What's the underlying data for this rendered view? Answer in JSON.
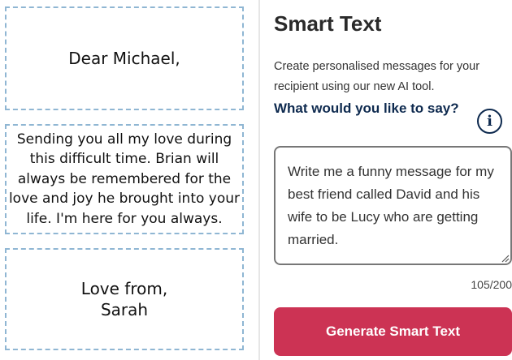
{
  "card": {
    "greeting": "Dear Michael,",
    "message_lines": [
      "Sending you all my love during",
      "this difficult time. Brian will",
      "always be remembered for the",
      "love and joy he brought into your",
      "life. I'm here for you always."
    ],
    "signoff_lines": [
      "Love from,",
      "Sarah"
    ]
  },
  "panel": {
    "title": "Smart Text",
    "description": "Create personalised messages for your recipient using our new AI tool.",
    "question": "What would you like to say?",
    "info_icon": "info-circle-icon",
    "prompt_value": "Write me a funny message for my best friend called David and his wife to be Lucy who are getting married.",
    "char_count": "105/200",
    "generate_label": "Generate Smart Text"
  },
  "colors": {
    "accent": "#cc3354",
    "heading_navy": "#0e2a4f",
    "dashed_border": "#8fb6d3"
  }
}
